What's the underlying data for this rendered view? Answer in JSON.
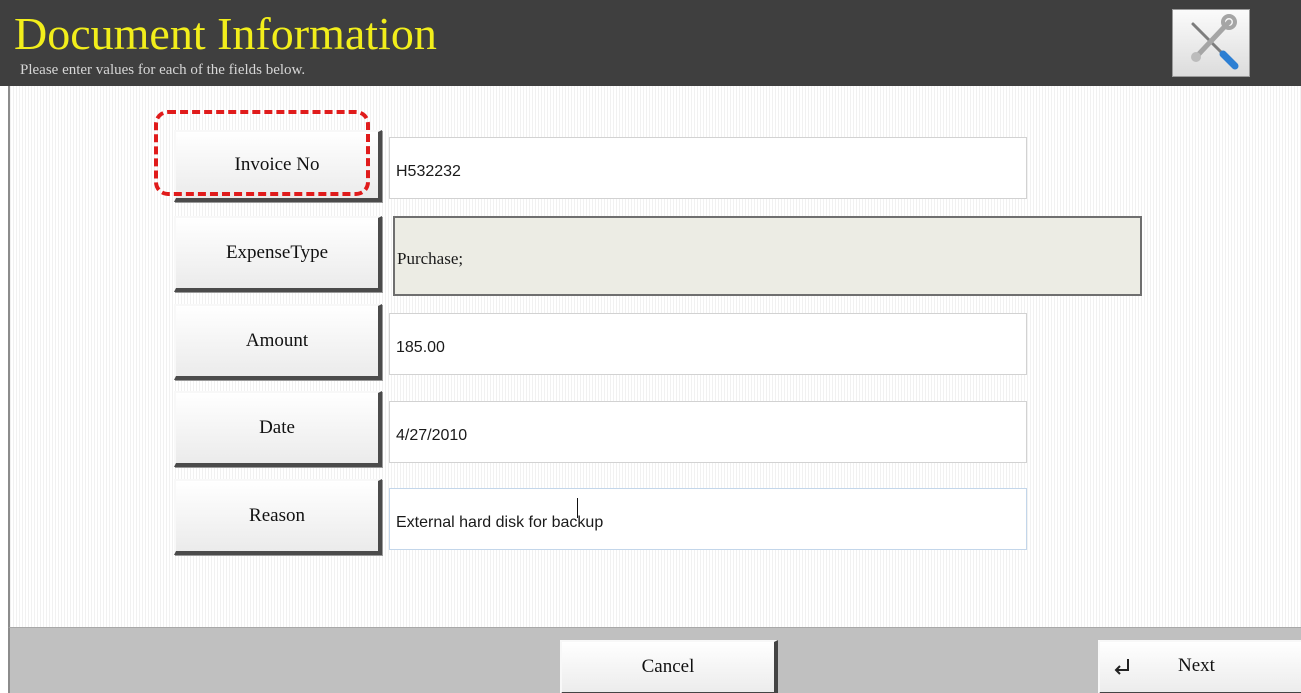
{
  "header": {
    "title": "Document Information",
    "subtitle": "Please enter values for each of the fields below.",
    "tools_icon": "tools-icon",
    "title_color": "#f2ee1b",
    "background_color": "#3f3f3f"
  },
  "form": {
    "fields": [
      {
        "label": "Invoice No",
        "value": "H532232"
      },
      {
        "label": "ExpenseType",
        "value": "Purchase;"
      },
      {
        "label": "Amount",
        "value": "185.00"
      },
      {
        "label": "Date",
        "value": "4/27/2010"
      },
      {
        "label": "Reason",
        "value": "External hard disk for backup"
      }
    ],
    "highlight_color": "#e01b1b"
  },
  "footer": {
    "cancel_label": "Cancel",
    "next_label": "Next",
    "next_icon": "return-arrow-icon"
  }
}
